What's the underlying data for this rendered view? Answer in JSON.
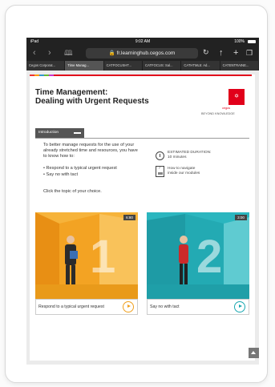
{
  "status": {
    "device": "iPad",
    "time": "9:02 AM",
    "battery": "100%"
  },
  "browser": {
    "url": "fr.learninghub.cegos.com"
  },
  "tabs": [
    {
      "label": "Cegos Corporat..."
    },
    {
      "label": "Time Manag..."
    },
    {
      "label": "CATFOCUSHT..."
    },
    {
      "label": "CATFOCUS: Sal..."
    },
    {
      "label": "CATHTML5: Ad..."
    },
    {
      "label": "CATENTRAINE..."
    }
  ],
  "page": {
    "title_line1": "Time Management:",
    "title_line2": "Dealing with Urgent Requests",
    "logo_text": "cegos",
    "tagline": "BEYOND KNOWLEDGE",
    "intro_label": "Introduction",
    "lead": "To better manage requests for the use of your already stretched time and resources, you have to know how to:",
    "bullets": [
      "Respond to a typical urgent request",
      "Say no with tact"
    ],
    "click_text": "Click the topic of your choice.",
    "estimated_label": "ESTIMATED DURATION:",
    "estimated_value": "10 minutes",
    "help_line1": "How to navigate",
    "help_line2": "inside our modules"
  },
  "modules": [
    {
      "number": "1",
      "duration": "6:80",
      "caption": "Respond to a typical urgent request",
      "color": "#f0a01e"
    },
    {
      "number": "2",
      "duration": "3:00",
      "caption": "Say no with tact",
      "color": "#1aa8b1"
    }
  ]
}
